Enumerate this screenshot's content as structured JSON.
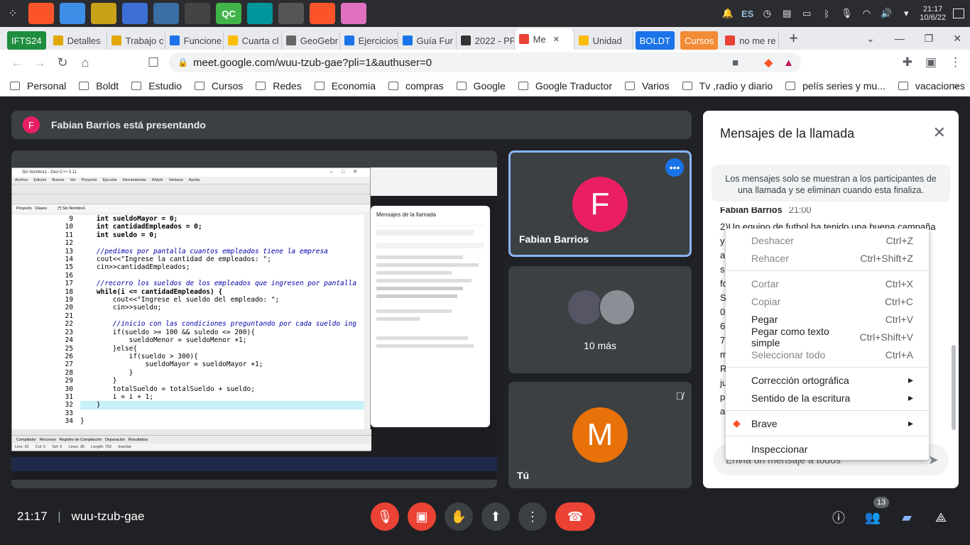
{
  "taskbar": {
    "apps": [
      {
        "name": "brave-app-icon",
        "label": "",
        "color": "#fb542b"
      },
      {
        "name": "files-app-icon",
        "label": "",
        "color": "#3d8ee6"
      },
      {
        "name": "network-app-icon",
        "label": "",
        "color": "#c9a21a"
      },
      {
        "name": "app-blue-icon",
        "label": "",
        "color": "#3b6fd6"
      },
      {
        "name": "editor-app-icon",
        "label": "",
        "color": "#3a6ea5"
      },
      {
        "name": "terminal-app-icon",
        "label": "",
        "color": "#444"
      },
      {
        "name": "qc-app-icon",
        "label": "QC",
        "color": "#41b54a"
      },
      {
        "name": "arduino-app-icon",
        "label": "",
        "color": "#00979c"
      },
      {
        "name": "atom-app-icon",
        "label": "",
        "color": "#555"
      },
      {
        "name": "brave-active-app-icon",
        "label": "",
        "color": "#fb542b"
      },
      {
        "name": "pink-app-icon",
        "label": "",
        "color": "#e070c0"
      }
    ],
    "tray": {
      "lang": "ES",
      "time": "21:17",
      "date": "10/6/22"
    }
  },
  "tabs": [
    {
      "label": "IFTS24",
      "pill": true,
      "color": "#1e8e3e"
    },
    {
      "label": "Detalles",
      "color": "#e0a800"
    },
    {
      "label": "Trabajo c",
      "color": "#e0a800"
    },
    {
      "label": "Funcione",
      "color": "#1a73e8"
    },
    {
      "label": "Cuarta cl",
      "color": "#fbbc04"
    },
    {
      "label": "GeoGebr",
      "color": "#666"
    },
    {
      "label": "Ejercicios",
      "color": "#1a73e8"
    },
    {
      "label": "Guía Fur",
      "color": "#1a73e8"
    },
    {
      "label": "2022 - PF",
      "color": "#333"
    },
    {
      "label": "Me",
      "active": true,
      "color": "#ea4335"
    },
    {
      "label": "Unidad",
      "color": "#fbbc04"
    },
    {
      "label": "BOLDT",
      "pill": true,
      "color": "#1a73e8"
    },
    {
      "label": "Cursos",
      "pill": true,
      "color": "#f28b35"
    },
    {
      "label": "no me re",
      "color": "#ea4335"
    }
  ],
  "address": {
    "url": "meet.google.com/wuu-tzub-gae?pli=1&authuser=0"
  },
  "bookmarks": [
    "Personal",
    "Boldt",
    "Estudio",
    "Cursos",
    "Redes",
    "Economia",
    "compras",
    "Google",
    "Google Traductor",
    "Varios",
    "Tv ,radio y diario",
    "pelís series y mu...",
    "vacaciones"
  ],
  "presenting": {
    "avatar": "F",
    "text": "Fabian Barrios está presentando"
  },
  "devcpp": {
    "title": "Sin Nombre1 - Dev-C++ 5.11",
    "menu": [
      "Archivo",
      "Edición",
      "Buscar",
      "Ver",
      "Proyecto",
      "Ejecutar",
      "Herramientas",
      "AStyle",
      "Ventana",
      "Ayuda"
    ],
    "code": [
      {
        "n": "9",
        "t": "    int sueldoMayor = 0;"
      },
      {
        "n": "10",
        "t": "    int cantidadEmpleados = 0;"
      },
      {
        "n": "11",
        "t": "    int sueldo = 0;"
      },
      {
        "n": "12",
        "t": ""
      },
      {
        "n": "13",
        "t": "    //pedimos por pantalla cuantos empleados tiene la empresa"
      },
      {
        "n": "14",
        "t": "    cout<<\"Ingrese la cantidad de empleados: \";"
      },
      {
        "n": "15",
        "t": "    cin>>cantidadEmpleados;"
      },
      {
        "n": "16",
        "t": ""
      },
      {
        "n": "17",
        "t": "    //recorro los sueldos de los empleados que ingresen por pantalla"
      },
      {
        "n": "18",
        "t": "    while(i <= cantidadEmpleados) {"
      },
      {
        "n": "19",
        "t": "        cout<<\"Ingrese el sueldo del empleado: \";"
      },
      {
        "n": "20",
        "t": "        cin>>sueldo;"
      },
      {
        "n": "21",
        "t": ""
      },
      {
        "n": "22",
        "t": "        //inicio con las condiciones preguntando por cada sueldo ing"
      },
      {
        "n": "23",
        "t": "        if(sueldo >= 100 && suledo <= 200){"
      },
      {
        "n": "24",
        "t": "            sueldoMenor = sueldoMenor +1;"
      },
      {
        "n": "25",
        "t": "        }else{"
      },
      {
        "n": "26",
        "t": "            if(sueldo > 300){"
      },
      {
        "n": "27",
        "t": "                sueldoMayor = sueldoMayor +1;"
      },
      {
        "n": "28",
        "t": "            }"
      },
      {
        "n": "29",
        "t": "        }"
      },
      {
        "n": "30",
        "t": "        totalSueldo = totalSueldo + sueldo;"
      },
      {
        "n": "31",
        "t": "        i = i + 1;"
      },
      {
        "n": "32",
        "t": "    }"
      },
      {
        "n": "33",
        "t": ""
      },
      {
        "n": "34",
        "t": "}"
      }
    ],
    "mini_chat_title": "Mensajes de la llamada"
  },
  "tiles": {
    "fabian": {
      "initial": "F",
      "name": "Fabian Barrios"
    },
    "more": {
      "label": "10 más"
    },
    "me": {
      "initial": "M",
      "name": "Tú"
    }
  },
  "chat": {
    "title": "Mensajes de la llamada",
    "info": "Los mensajes solo se muestran a los participantes de una llamada y se eliminan cuando esta finaliza.",
    "sender": "Fabian Barrios",
    "time": "21:00",
    "first_line": "2)Un equipo de futbol ha tenido una buena campaña",
    "placeholder": "Envía un mensaje a todos"
  },
  "context_menu": [
    {
      "label": "Deshacer",
      "shortcut": "Ctrl+Z",
      "disabled": true
    },
    {
      "label": "Rehacer",
      "shortcut": "Ctrl+Shift+Z",
      "disabled": true
    },
    {
      "sep": true
    },
    {
      "label": "Cortar",
      "shortcut": "Ctrl+X",
      "disabled": true
    },
    {
      "label": "Copiar",
      "shortcut": "Ctrl+C",
      "disabled": true
    },
    {
      "label": "Pegar",
      "shortcut": "Ctrl+V"
    },
    {
      "label": "Pegar como texto simple",
      "shortcut": "Ctrl+Shift+V"
    },
    {
      "label": "Seleccionar todo",
      "shortcut": "Ctrl+A",
      "disabled": true
    },
    {
      "sep": true
    },
    {
      "label": "Corrección ortográfica",
      "submenu": true
    },
    {
      "label": "Sentido de la escritura",
      "submenu": true
    },
    {
      "sep": true
    },
    {
      "label": "Brave",
      "submenu": true,
      "icon": true
    },
    {
      "sep": true
    },
    {
      "label": "Inspeccionar"
    }
  ],
  "bottom": {
    "time": "21:17",
    "code": "wuu-tzub-gae",
    "participants": "13"
  }
}
